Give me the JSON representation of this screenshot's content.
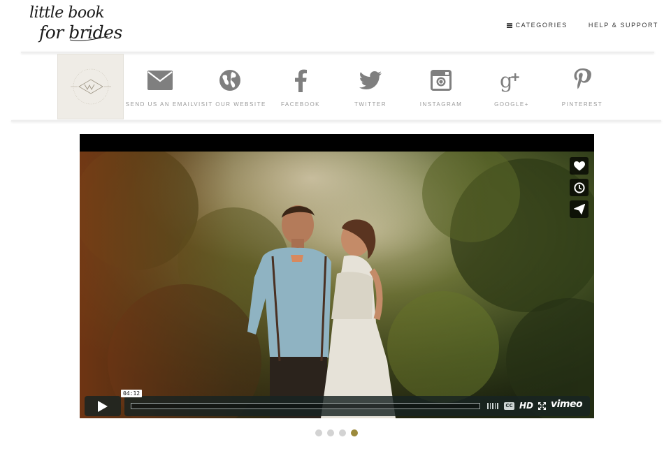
{
  "header": {
    "logo": {
      "line1": "little book",
      "line2": "for brides"
    },
    "nav": [
      {
        "label": "CATEGORIES",
        "icon": "menu-icon"
      },
      {
        "label": "HELP & SUPPORT"
      }
    ]
  },
  "vendor": {
    "thumbnail_icon": "vendor-logo-thumbnail"
  },
  "contact_links": [
    {
      "label": "SEND US AN EMAIL",
      "icon": "envelope-icon"
    },
    {
      "label": "VISIT OUR WEBSITE",
      "icon": "globe-icon"
    },
    {
      "label": "FACEBOOK",
      "icon": "facebook-icon"
    },
    {
      "label": "TWITTER",
      "icon": "twitter-icon"
    },
    {
      "label": "INSTAGRAM",
      "icon": "instagram-icon"
    },
    {
      "label": "GOOGLE+",
      "icon": "google-plus-icon"
    },
    {
      "label": "PINTEREST",
      "icon": "pinterest-icon"
    }
  ],
  "video": {
    "duration": "04:12",
    "progress": 0,
    "hd_label": "HD",
    "cc_label": "CC",
    "brand": "vimeo",
    "side_actions": [
      "heart-icon",
      "clock-icon",
      "paper-plane-icon"
    ]
  },
  "carousel": {
    "count": 4,
    "active_index": 3
  },
  "colors": {
    "accent": "#9c8a3c",
    "icon_gray": "#7f7f7f",
    "player_bg": "#172322"
  }
}
